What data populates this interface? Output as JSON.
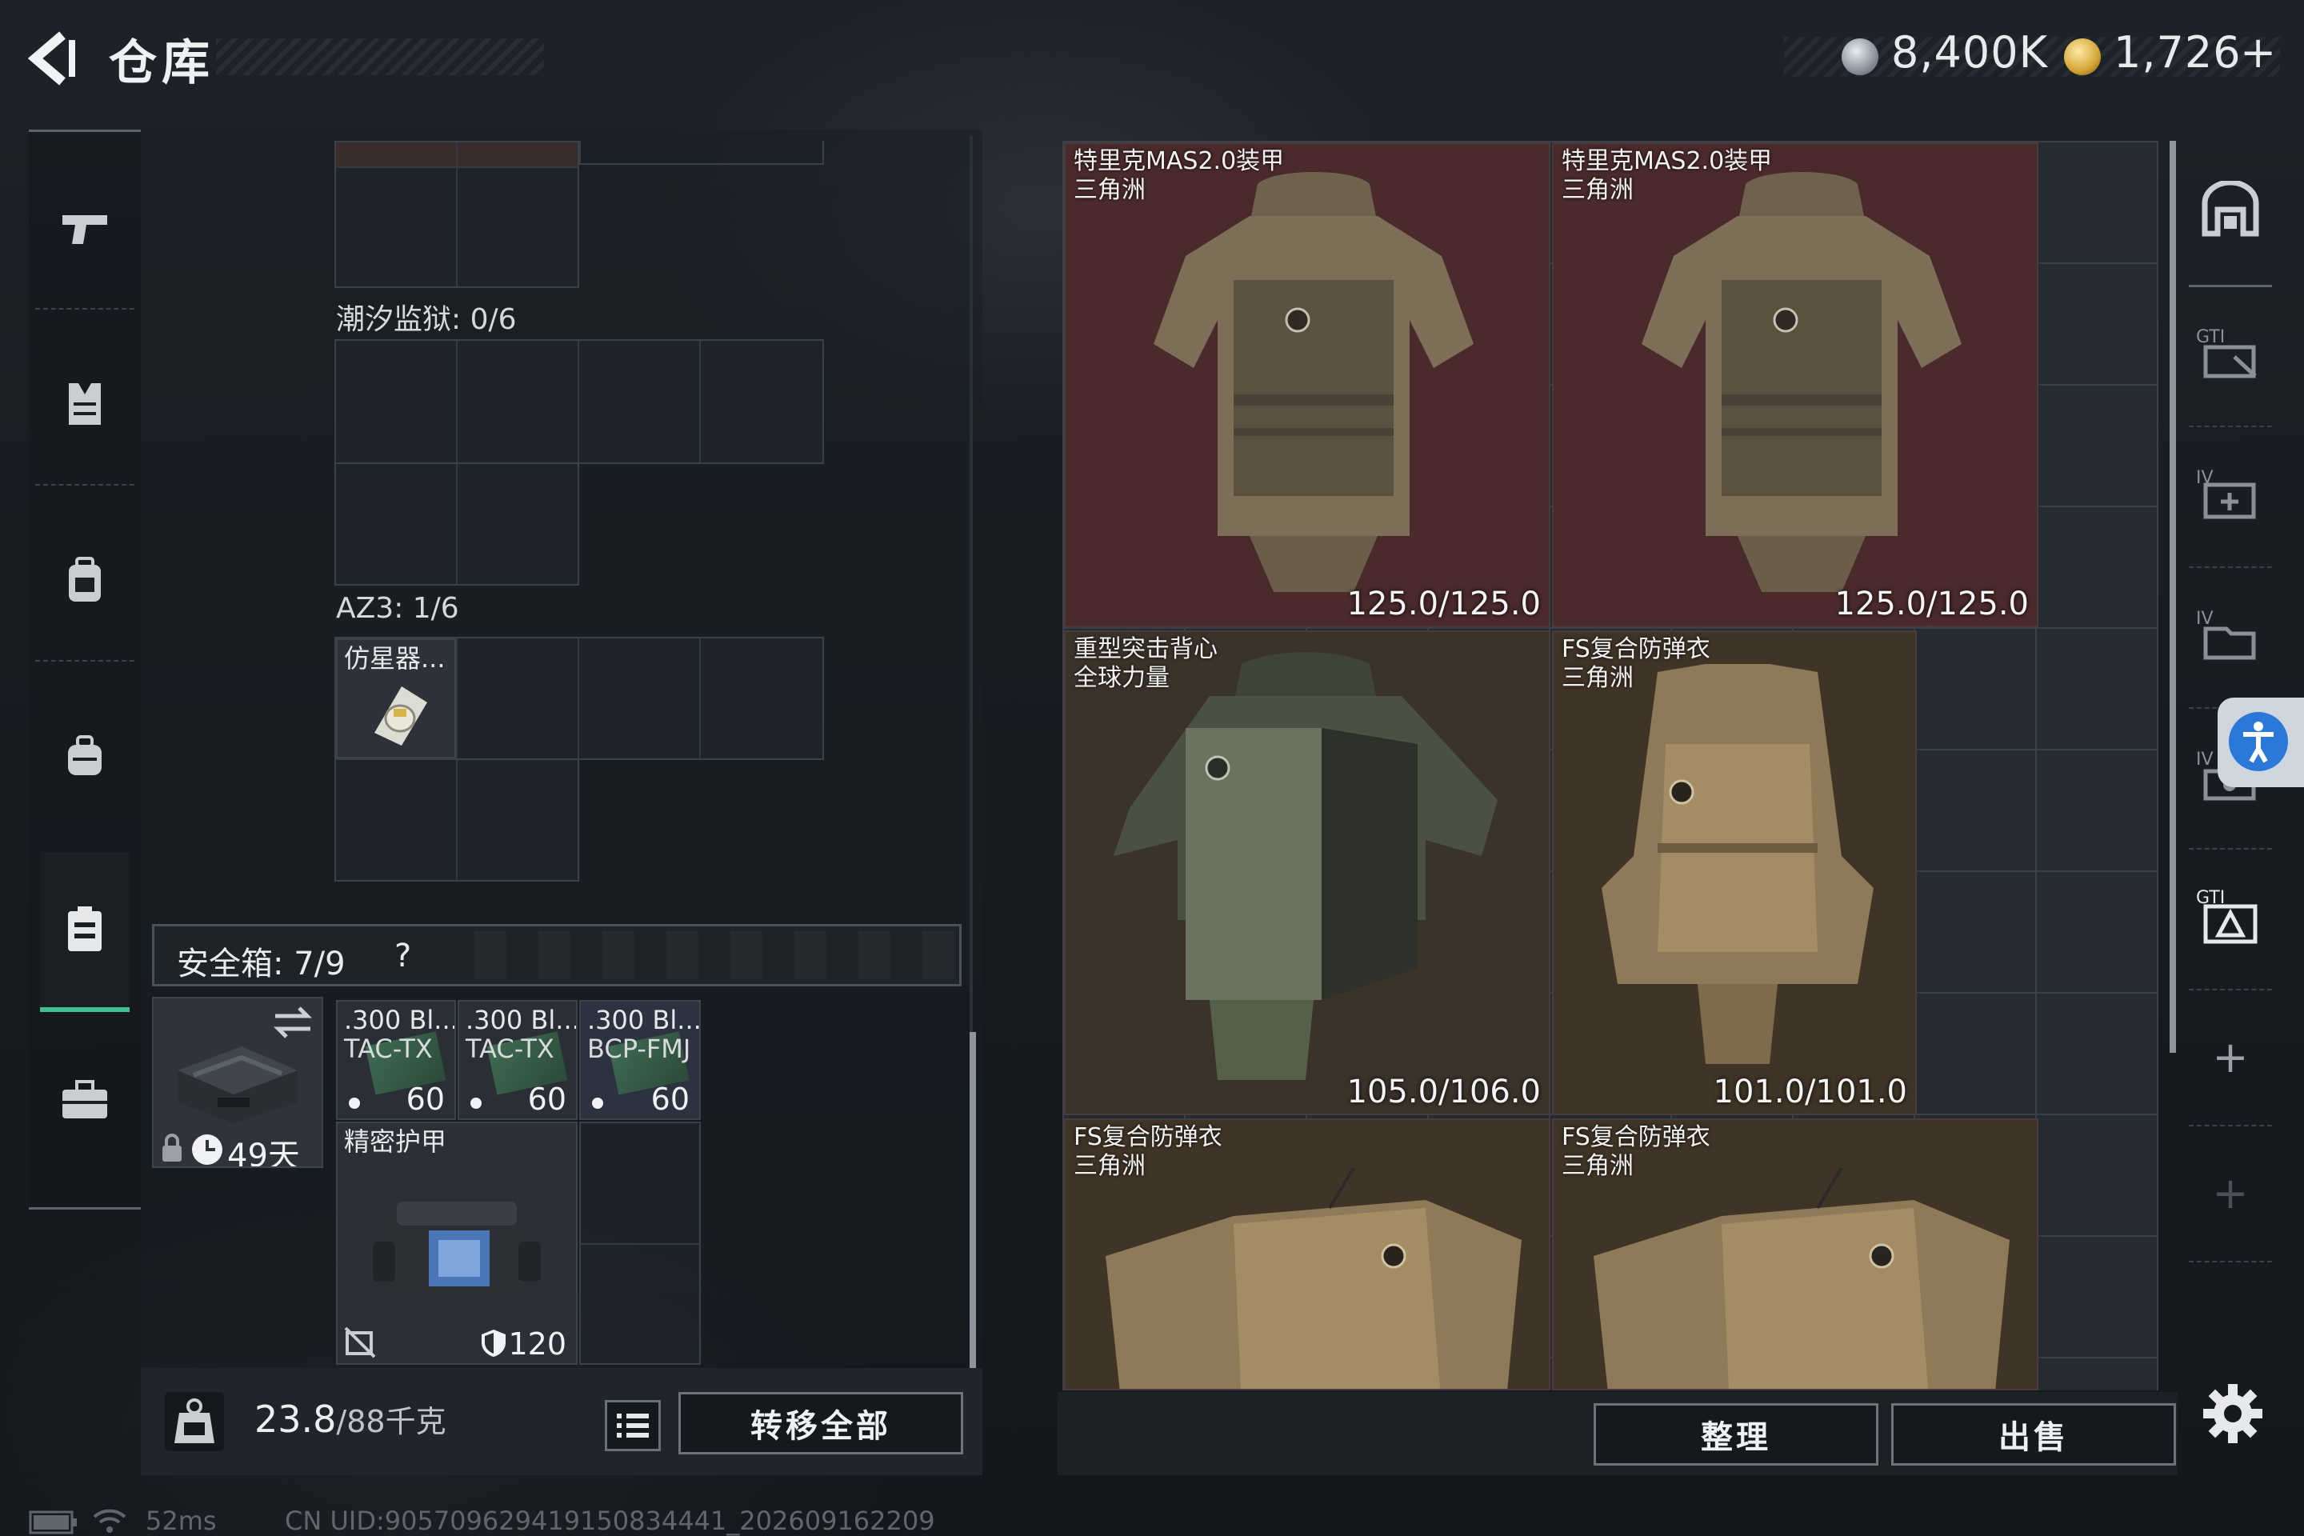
{
  "header": {
    "title": "仓库",
    "currency_1": "8,400K",
    "currency_2": "1,726",
    "add_symbol": "+"
  },
  "container": {
    "prison_label": "潮汐监狱: 0/6",
    "az3_label": "AZ3: 1/6",
    "az3_item_name": "仿星器..."
  },
  "safebox": {
    "label": "安全箱: 7/9",
    "help": "?",
    "timer": "49天",
    "ammo": [
      {
        "line1": ".300 Bl...",
        "line2": "TAC-TX",
        "count": "60"
      },
      {
        "line1": ".300 Bl...",
        "line2": "TAC-TX",
        "count": "60"
      },
      {
        "line1": ".300 Bl...",
        "line2": "BCP-FMJ",
        "count": "60"
      }
    ],
    "armor_case": {
      "name": "精密护甲",
      "durability": "120"
    }
  },
  "bottom_left": {
    "weight_value": "23.8",
    "weight_max": "/88千克",
    "transfer_all": "转移全部"
  },
  "stash_items": [
    {
      "name": "特里克MAS2.0装甲",
      "origin": "三角洲",
      "durability": "125.0/125.0"
    },
    {
      "name": "特里克MAS2.0装甲",
      "origin": "三角洲",
      "durability": "125.0/125.0"
    },
    {
      "name": "重型突击背心",
      "origin": "全球力量",
      "durability": "105.0/106.0"
    },
    {
      "name": "FS复合防弹衣",
      "origin": "三角洲",
      "durability": "101.0/101.0"
    },
    {
      "name": "FS复合防弹衣",
      "origin": "三角洲",
      "durability": ""
    },
    {
      "name": "FS复合防弹衣",
      "origin": "三角洲",
      "durability": ""
    }
  ],
  "bottom_right": {
    "sort": "整理",
    "sell": "出售"
  },
  "right_nav": {
    "plus1": "+",
    "plus2": "+"
  },
  "status": {
    "ping": "52ms",
    "uid": "CN UID:905709629419150834441_202609162209"
  },
  "colors": {
    "accent_green": "#3fbf8f",
    "vest_red": "#4b2a2b",
    "vest_olive": "#3b332a",
    "access_blue": "#2b78d8"
  }
}
